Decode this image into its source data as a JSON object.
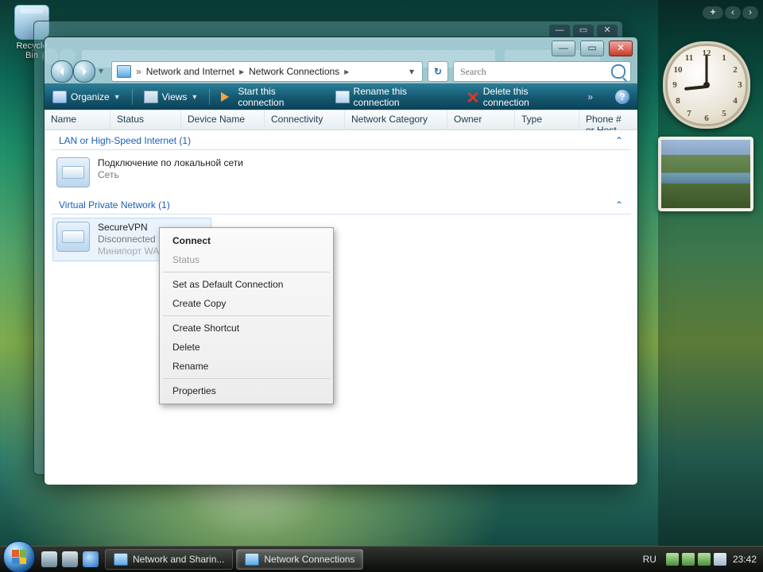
{
  "desktop": {
    "recycle_bin": "Recycle Bin"
  },
  "window": {
    "titlebar": {
      "min": "—",
      "max": "▭",
      "close": "✕"
    },
    "breadcrumb": {
      "root_glyph": "«",
      "seg1": "Network and Internet",
      "seg2": "Network Connections"
    },
    "search_placeholder": "Search",
    "refresh_glyph": "↻",
    "toolbar": {
      "organize": "Organize",
      "views": "Views",
      "start": "Start this connection",
      "rename": "Rename this connection",
      "del": "Delete this connection",
      "overflow": "»",
      "help": "?"
    },
    "columns": {
      "name": "Name",
      "status": "Status",
      "device": "Device Name",
      "connectivity": "Connectivity",
      "netcat": "Network Category",
      "owner": "Owner",
      "type": "Type",
      "phone": "Phone # or Host Addre..."
    },
    "groups": {
      "lan": "LAN or High-Speed Internet (1)",
      "vpn": "Virtual Private Network (1)",
      "collapse_glyph": "⌃"
    },
    "conn_lan": {
      "name": "Подключение по локальной сети",
      "status": "Сеть",
      "device": ""
    },
    "conn_vpn": {
      "name": "SecureVPN",
      "status": "Disconnected",
      "device": "Минипорт WAN"
    }
  },
  "context_menu": {
    "connect": "Connect",
    "status": "Status",
    "set_default": "Set as Default Connection",
    "create_copy": "Create Copy",
    "create_shortcut": "Create Shortcut",
    "delete": "Delete",
    "rename": "Rename",
    "properties": "Properties"
  },
  "ghost_window": {
    "min": "—",
    "max": "▭",
    "close": "✕"
  },
  "clock_numbers": {
    "n12": "12",
    "n1": "1",
    "n2": "2",
    "n3": "3",
    "n4": "4",
    "n5": "5",
    "n6": "6",
    "n7": "7",
    "n8": "8",
    "n9": "9",
    "n10": "10",
    "n11": "11"
  },
  "sidebar_controls": {
    "plus": "+",
    "left": "‹",
    "right": "›"
  },
  "taskbar": {
    "task1": "Network and Sharin...",
    "task2": "Network Connections",
    "lang": "RU",
    "time": "23:42"
  }
}
